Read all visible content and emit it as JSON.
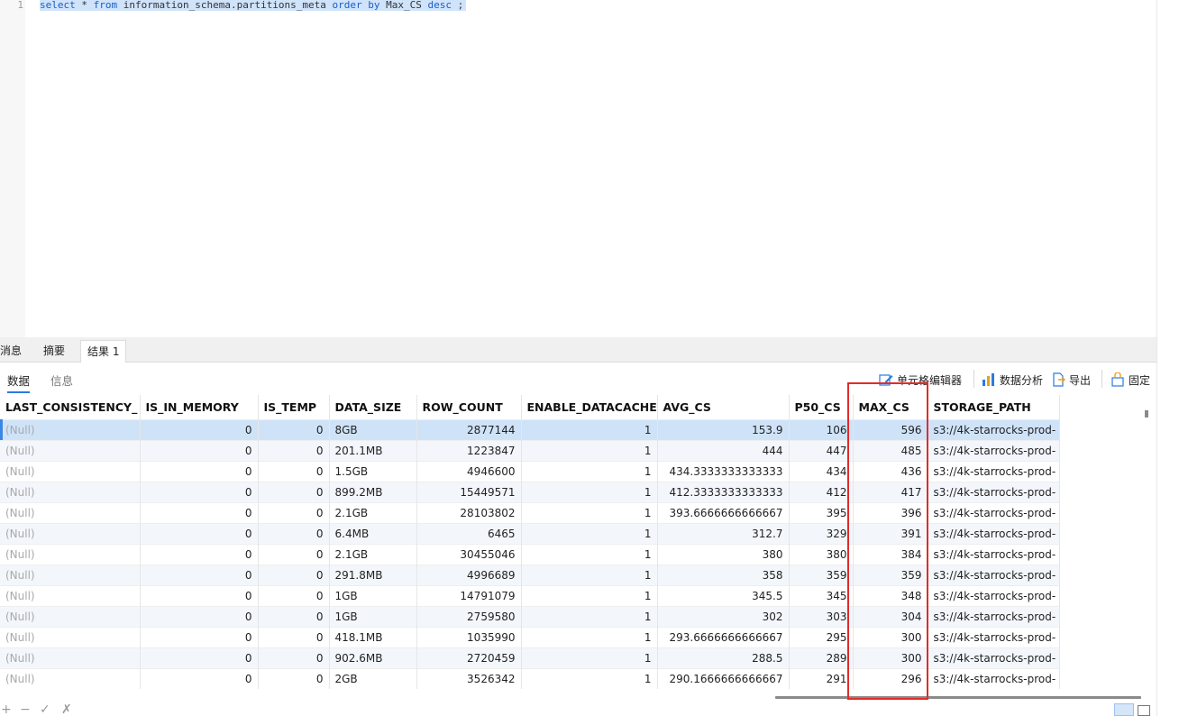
{
  "editor": {
    "line_number": "1",
    "sql": {
      "kw_select": "select",
      "star": " * ",
      "kw_from": "from",
      "table": " information_schema.partitions_meta ",
      "kw_order": "order",
      "sp1": " ",
      "kw_by": "by",
      "column": " Max_CS ",
      "kw_desc": "desc",
      "end": " ;"
    }
  },
  "bottom_tabs": [
    "消息",
    "摘要",
    "结果 1"
  ],
  "sub_tabs": [
    "数据",
    "信息"
  ],
  "toolbar": {
    "cell_editor": "单元格编辑器",
    "data_analysis": "数据分析",
    "export": "导出",
    "pin": "固定"
  },
  "grid": {
    "columns": [
      "LAST_CONSISTENCY_",
      "IS_IN_MEMORY",
      "IS_TEMP",
      "DATA_SIZE",
      "ROW_COUNT",
      "ENABLE_DATACACHE",
      "AVG_CS",
      "P50_CS",
      "MAX_CS",
      "STORAGE_PATH"
    ],
    "rows": [
      [
        "(Null)",
        "0",
        "0",
        "8GB",
        "2877144",
        "1",
        "153.9",
        "106",
        "596",
        "s3://4k-starrocks-prod-"
      ],
      [
        "(Null)",
        "0",
        "0",
        "201.1MB",
        "1223847",
        "1",
        "444",
        "447",
        "485",
        "s3://4k-starrocks-prod-"
      ],
      [
        "(Null)",
        "0",
        "0",
        "1.5GB",
        "4946600",
        "1",
        "434.3333333333333",
        "434",
        "436",
        "s3://4k-starrocks-prod-"
      ],
      [
        "(Null)",
        "0",
        "0",
        "899.2MB",
        "15449571",
        "1",
        "412.3333333333333",
        "412",
        "417",
        "s3://4k-starrocks-prod-"
      ],
      [
        "(Null)",
        "0",
        "0",
        "2.1GB",
        "28103802",
        "1",
        "393.6666666666667",
        "395",
        "396",
        "s3://4k-starrocks-prod-"
      ],
      [
        "(Null)",
        "0",
        "0",
        "6.4MB",
        "6465",
        "1",
        "312.7",
        "329",
        "391",
        "s3://4k-starrocks-prod-"
      ],
      [
        "(Null)",
        "0",
        "0",
        "2.1GB",
        "30455046",
        "1",
        "380",
        "380",
        "384",
        "s3://4k-starrocks-prod-"
      ],
      [
        "(Null)",
        "0",
        "0",
        "291.8MB",
        "4996689",
        "1",
        "358",
        "359",
        "359",
        "s3://4k-starrocks-prod-"
      ],
      [
        "(Null)",
        "0",
        "0",
        "1GB",
        "14791079",
        "1",
        "345.5",
        "345",
        "348",
        "s3://4k-starrocks-prod-"
      ],
      [
        "(Null)",
        "0",
        "0",
        "1GB",
        "2759580",
        "1",
        "302",
        "303",
        "304",
        "s3://4k-starrocks-prod-"
      ],
      [
        "(Null)",
        "0",
        "0",
        "418.1MB",
        "1035990",
        "1",
        "293.6666666666667",
        "295",
        "300",
        "s3://4k-starrocks-prod-"
      ],
      [
        "(Null)",
        "0",
        "0",
        "902.6MB",
        "2720459",
        "1",
        "288.5",
        "289",
        "300",
        "s3://4k-starrocks-prod-"
      ],
      [
        "(Null)",
        "0",
        "0",
        "2GB",
        "3526342",
        "1",
        "290.1666666666667",
        "291",
        "296",
        "s3://4k-starrocks-prod-"
      ]
    ]
  },
  "footer": {
    "add": "+",
    "remove": "−",
    "apply": "✓",
    "discard": "✗"
  },
  "colors": {
    "selection": "#cfe3fa",
    "keyword": "#1a5ec8",
    "highlight_box": "#e32a2a",
    "null_text": "#a9a9a9"
  }
}
